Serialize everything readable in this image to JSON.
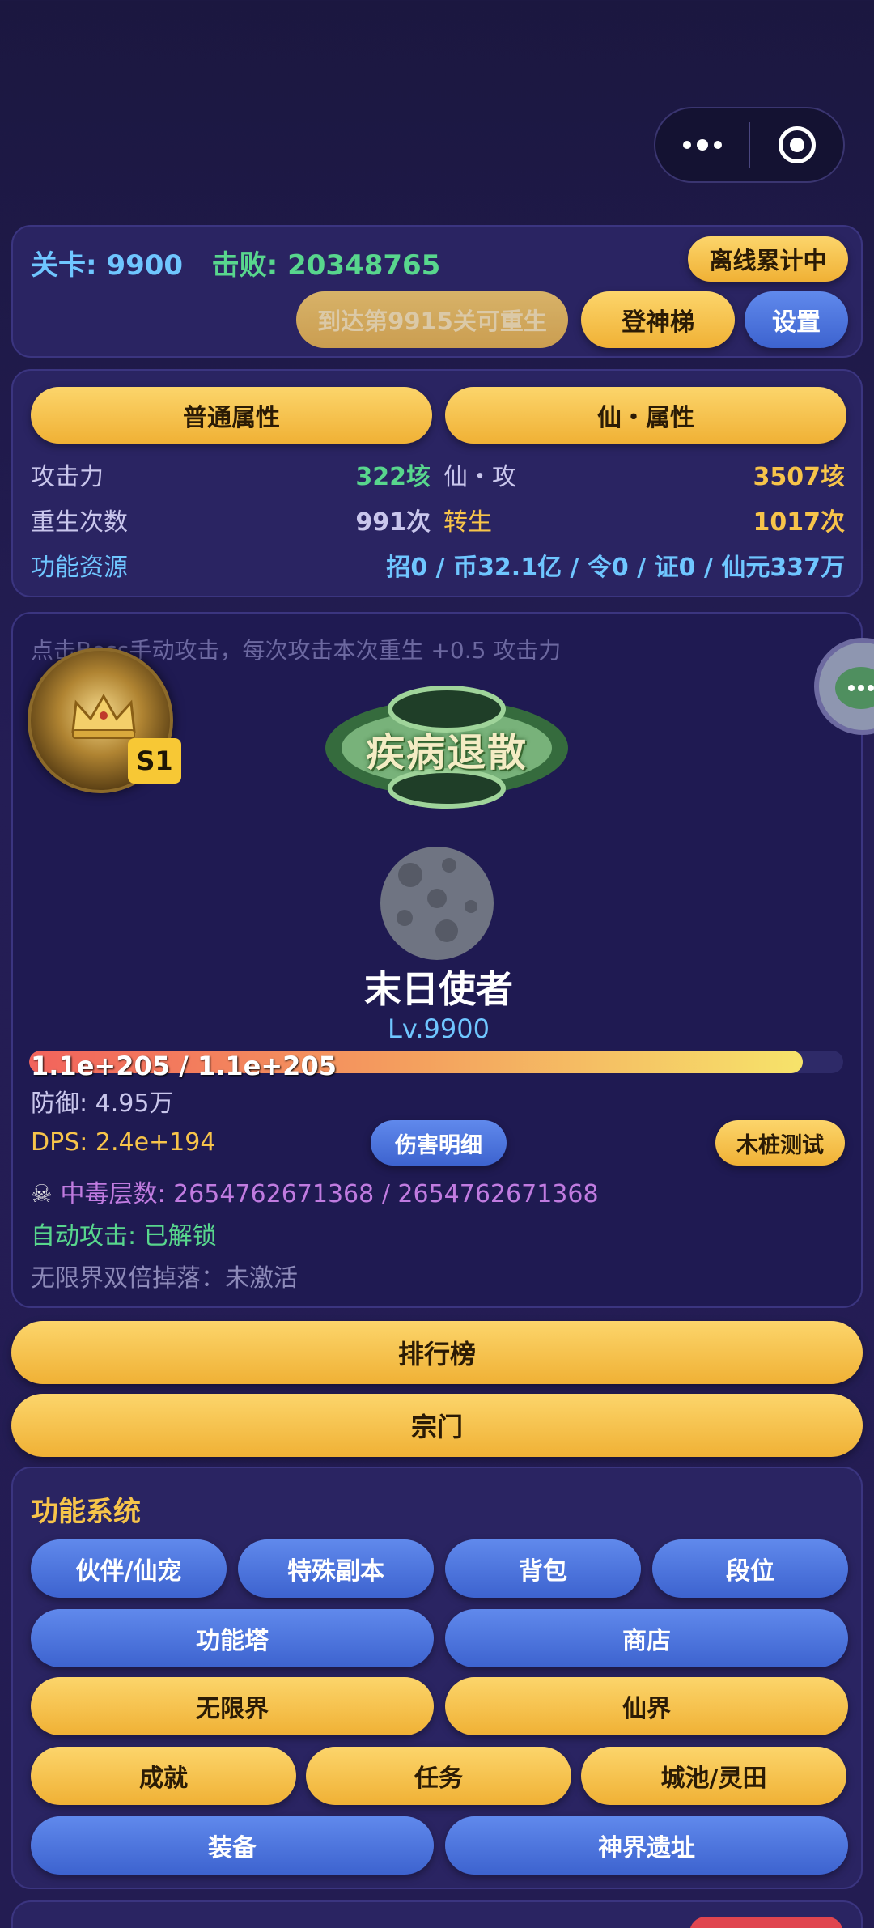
{
  "capsule": {
    "more_icon": "more-dots-icon",
    "close_icon": "target-close-icon"
  },
  "header": {
    "stage_label": "关卡:",
    "stage_value": "9900",
    "defeat_label": "击败:",
    "defeat_value": "20348765",
    "offline_button": "离线累计中",
    "rebirth_button": "到达第9915关可重生",
    "ladder_button": "登神梯",
    "settings_button": "设置"
  },
  "attributes": {
    "tab_normal": "普通属性",
    "tab_immortal": "仙・属性",
    "attack_label": "攻击力",
    "attack_value": "322垓",
    "immortal_attack_label": "仙・攻",
    "immortal_attack_value": "3507垓",
    "rebirth_label": "重生次数",
    "rebirth_value": "991次",
    "reincarnate_label": "转生",
    "reincarnate_value": "1017次",
    "resource_label": "功能资源",
    "resource_value": "招0 / 币32.1亿 / 令0 / 证0 / 仙元337万"
  },
  "battle": {
    "hint": "点击Boss手动攻击，每次攻击本次重生 +0.5 攻击力",
    "season_badge": "S1",
    "title_emblem": "疾病退散",
    "boss_name": "末日使者",
    "boss_level": "Lv.9900",
    "hp_text": "1.1e+205 / 1.1e+205",
    "hp_fraction": 0.95,
    "defense": "防御: 4.95万",
    "dps": "DPS: 2.4e+194",
    "damage_detail_button": "伤害明细",
    "dummy_test_button": "木桩测试",
    "poison_icon": "☠",
    "poison_text": "中毒层数: 2654762671368 / 2654762671368",
    "auto_attack": "自动攻击: 已解锁",
    "infinite_drop": "无限界双倍掉落：未激活"
  },
  "main_buttons": {
    "leaderboard": "排行榜",
    "sect": "宗门"
  },
  "functions": {
    "title": "功能系统",
    "partner": "伙伴/仙宠",
    "special_dungeon": "特殊副本",
    "backpack": "背包",
    "rank": "段位",
    "tower": "功能塔",
    "shop": "商店",
    "infinite_realm": "无限界",
    "immortal_realm": "仙界",
    "achievement": "成就",
    "task": "任务",
    "city": "城池/灵田",
    "equipment": "装备",
    "divine_ruins": "神界遗址"
  },
  "colors": {
    "gold": "#f7c44a",
    "blue": "#6fc6ff",
    "green": "#58d68d",
    "purple": "#c07be0",
    "panel": "#2a2462"
  }
}
